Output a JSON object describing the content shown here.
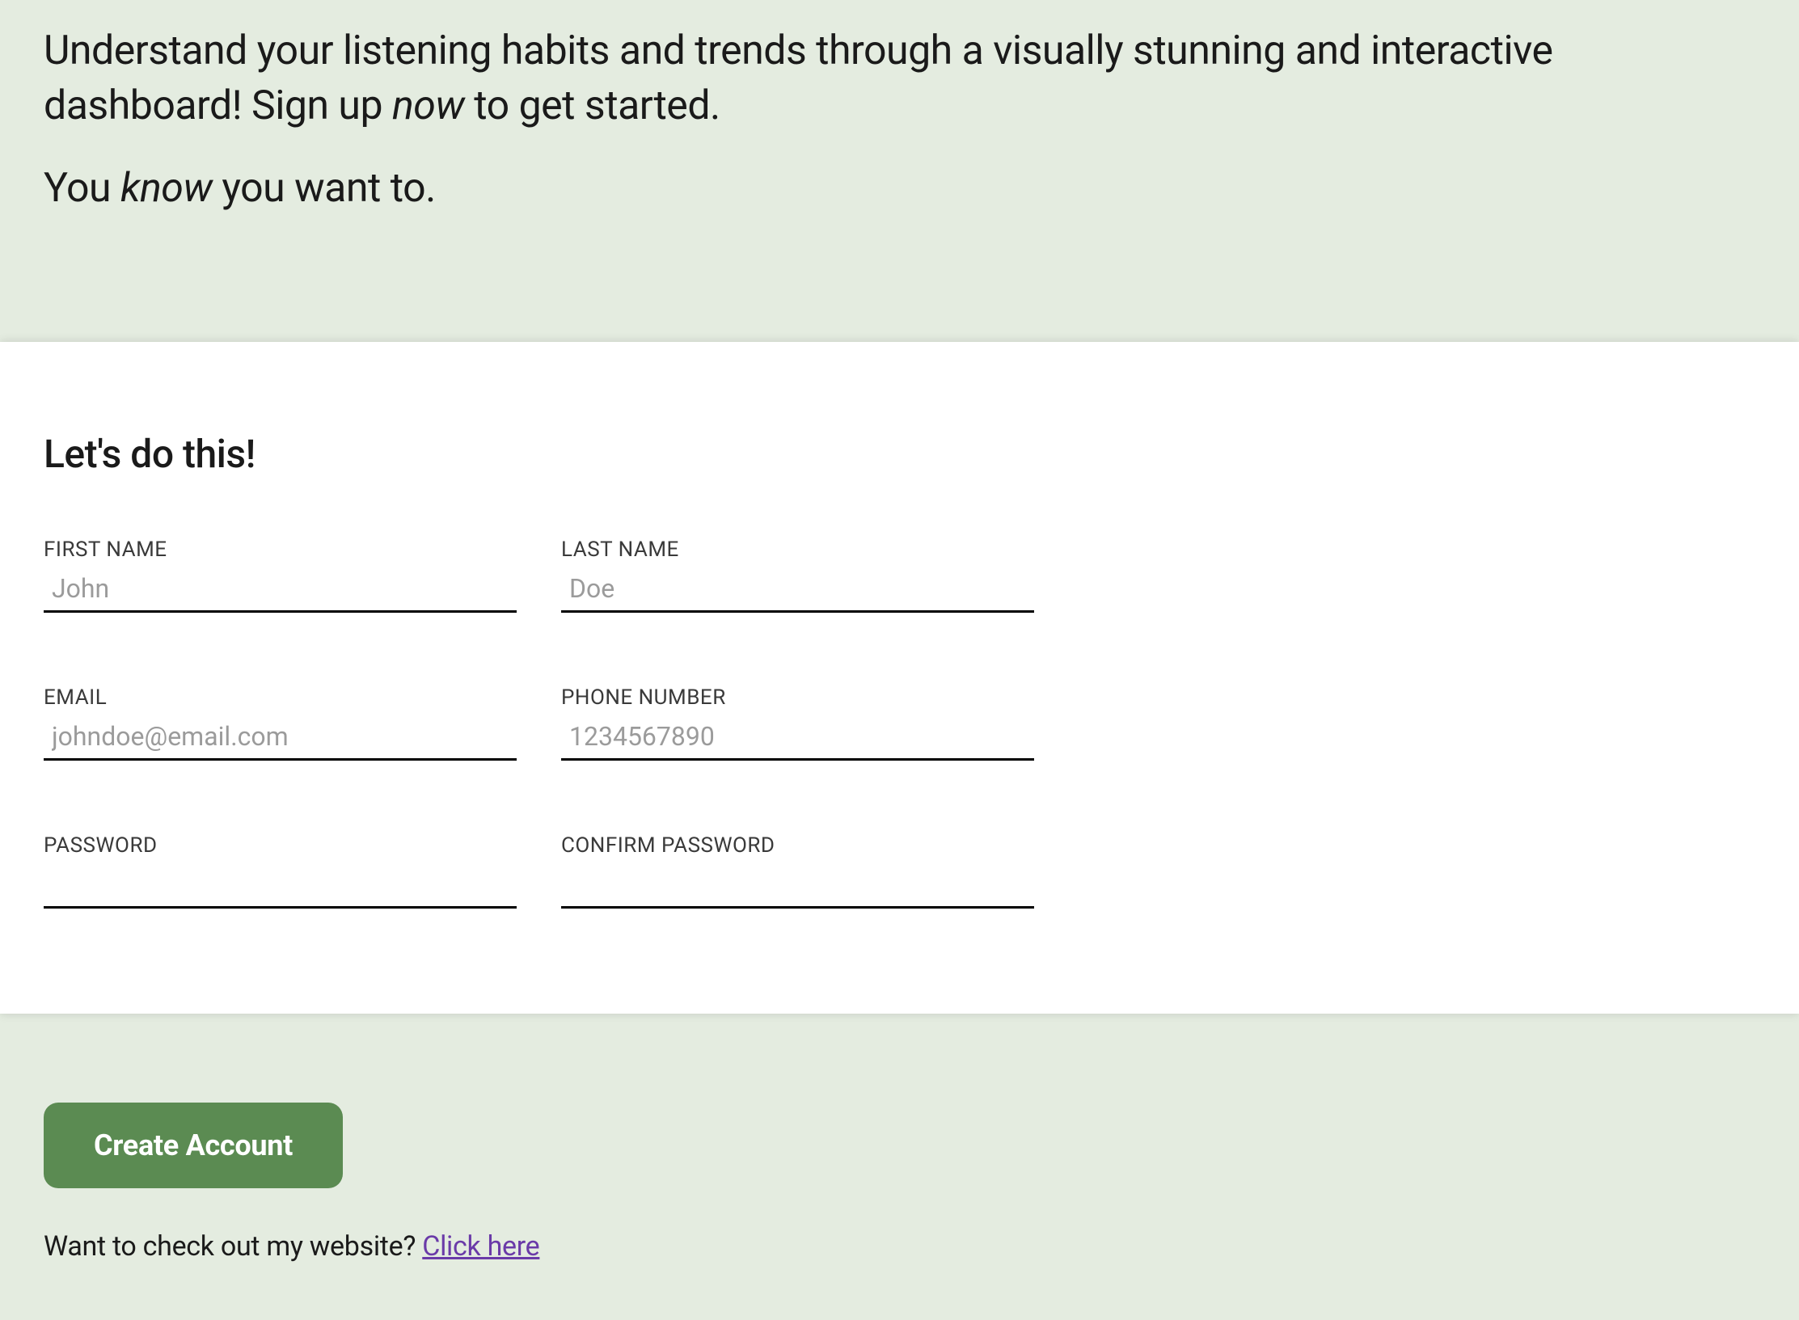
{
  "hero": {
    "p1_a": "Understand your listening habits and trends through a visually stunning and interactive dashboard! Sign up ",
    "p1_em": "now",
    "p1_b": " to get started.",
    "p2_a": "You ",
    "p2_em": "know",
    "p2_b": " you want to."
  },
  "form": {
    "title": "Let's do this!",
    "fields": {
      "first_name": {
        "label": "FIRST NAME",
        "placeholder": "John"
      },
      "last_name": {
        "label": "LAST NAME",
        "placeholder": "Doe"
      },
      "email": {
        "label": "EMAIL",
        "placeholder": "johndoe@email.com"
      },
      "phone": {
        "label": "PHONE NUMBER",
        "placeholder": "1234567890"
      },
      "password": {
        "label": "PASSWORD",
        "placeholder": ""
      },
      "confirm_password": {
        "label": "CONFIRM PASSWORD",
        "placeholder": ""
      }
    }
  },
  "footer": {
    "button_label": "Create Account",
    "website_text": "Want to check out my website? ",
    "website_link_text": "Click here"
  },
  "colors": {
    "page_bg": "#e4ece0",
    "button_bg": "#5b8b52",
    "link": "#6a3aa8"
  }
}
